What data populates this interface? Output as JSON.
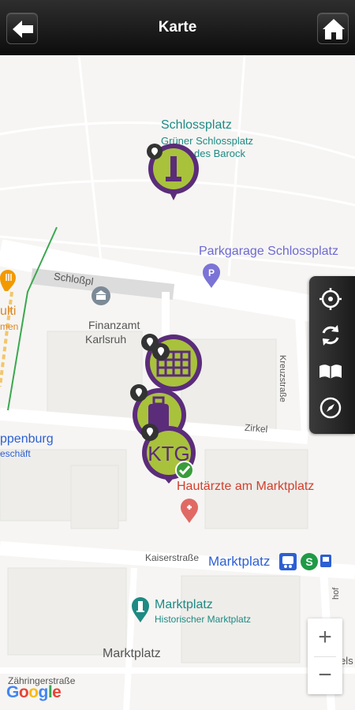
{
  "header": {
    "title": "Karte",
    "back_icon": "back-arrow-icon",
    "home_icon": "home-icon"
  },
  "map": {
    "labels": {
      "schlossplatz": "Schlossplatz",
      "gruener_line1": "Grüner Schlossplatz",
      "gruener_line2": "des Barock",
      "parkgarage": "Parkgarage Schlossplatz",
      "schlossplatz_street": "Schloßpl",
      "finanzamt_line1": "Finanzamt",
      "finanzamt_line2": "Karlsruh",
      "kreuzstrasse": "Kreuzstraße",
      "zirkel": "Zirkel",
      "penburg": "ppenburg",
      "geschaeft": "eschäft",
      "multi": "ulti",
      "men": "men",
      "hautaerzte": "Hautärzte am Marktplatz",
      "kaiserstrasse": "Kaiserstraße",
      "marktplatz_stop": "Marktplatz",
      "marktplatz_poi": "Marktplatz",
      "historischer": "Historischer Marktplatz",
      "marktplatz_area": "Marktplatz",
      "zaehringerstrasse": "Zähringerstraße",
      "handels": "Handels",
      "hof": "hof"
    },
    "google_logo": "Google",
    "zoom": {
      "in": "+",
      "out": "−"
    },
    "tools": [
      "locate-icon",
      "refresh-icon",
      "book-icon",
      "compass-icon"
    ],
    "colors": {
      "marker_purple": "#5b2c7a",
      "marker_lime": "#a9c23c",
      "teal_label": "#1e8a83",
      "transit_blue": "#2d5fd3",
      "red_label": "#d23f2d",
      "check_green": "#3a9d3a"
    }
  }
}
